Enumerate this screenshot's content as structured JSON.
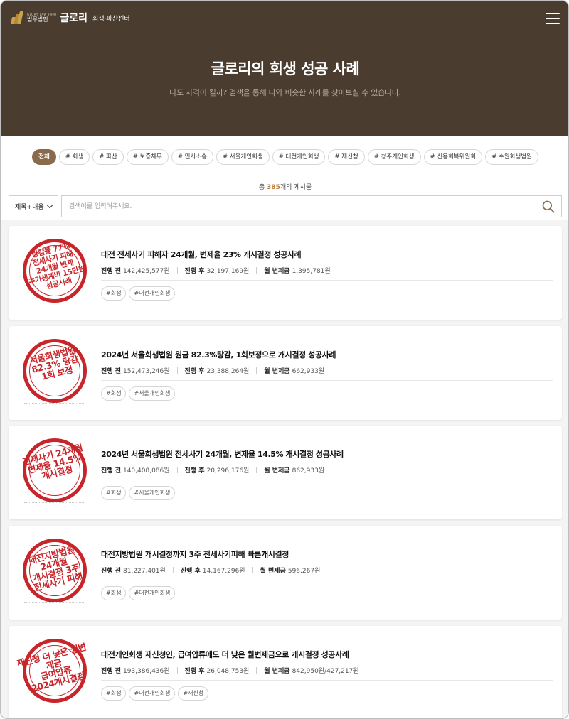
{
  "header": {
    "logo_en": "GLORY LAW FIRM",
    "logo_firm": "법무법인",
    "logo_name": "글로리",
    "logo_sub": "회생·파산센터",
    "title": "글로리의 회생 성공 사례",
    "subtitle": "나도 자격이 될까? 검색을 통해 나와 비슷한 사례를 찾아보실 수 있습니다."
  },
  "filters": {
    "tags": [
      "전체",
      "# 회생",
      "# 파산",
      "# 보증채무",
      "# 민사소송",
      "# 서울개인회생",
      "# 대전개인회생",
      "# 재신청",
      "# 청주개인회생",
      "# 신용회복위원회",
      "# 수원회생법원"
    ]
  },
  "total": {
    "prefix": "총 ",
    "count": "385",
    "suffix": "개의 게시물"
  },
  "search": {
    "select_value": "제목+내용",
    "placeholder": "검색어를 입력해주세요."
  },
  "labels": {
    "before": "진행 전",
    "after": "진행 후",
    "monthly": "월 변제금"
  },
  "cases": [
    {
      "title": "대전 전세사기 피해자 24개월, 변제율 23% 개시결정 성공사례",
      "before": "142,425,577원",
      "after": "32,197,169원",
      "monthly": "1,395,781원",
      "tags": [
        "#회생",
        "#대전개인회생"
      ],
      "stamp": [
        "탕감률 77%",
        "전세사기 피해",
        "24개월 변제",
        "추가생계비 15만원",
        "성공사례"
      ]
    },
    {
      "title": "2024년 서울회생법원 원금 82.3%탕감, 1회보정으로 개시결정 성공사례",
      "before": "152,473,246원",
      "after": "23,388,264원",
      "monthly": "662,933원",
      "tags": [
        "#회생",
        "#서울개인회생"
      ],
      "stamp": [
        "서울회생법원",
        "82.3% 탕감",
        "1회 보정"
      ]
    },
    {
      "title": "2024년 서울회생법원 전세사기 24개월, 변제율 14.5% 개시결정 성공사례",
      "before": "140,408,086원",
      "after": "20,296,176원",
      "monthly": "862,933원",
      "tags": [
        "#회생",
        "#서울개인회생"
      ],
      "stamp": [
        "전세사기 24개월",
        "변제율 14.5%",
        "개시결정"
      ]
    },
    {
      "title": "대전지방법원 개시결정까지 3주 전세사기피해 빠른개시결정",
      "before": "81,227,401원",
      "after": "14,167,296원",
      "monthly": "596,267원",
      "tags": [
        "#회생",
        "#대전개인회생"
      ],
      "stamp": [
        "대전지방법원",
        "24개월",
        "개시결정 3주",
        "전세사기 피해"
      ]
    },
    {
      "title": "대전개인회생 재신청인, 급여압류에도 더 낮은 월변제금으로 개시결정 성공사례",
      "before": "193,386,436원",
      "after": "26,048,753원",
      "monthly": "842,950원/427,217원",
      "tags": [
        "#회생",
        "#대전개인회생",
        "#재신청"
      ],
      "stamp": [
        "재신청 더 낮은 월변제금",
        "급여압류",
        "2024개시결정"
      ]
    }
  ],
  "colors": {
    "hero_bg": "#4a3d30",
    "accent": "#8a6a4c",
    "stamp_red": "#c8252b",
    "count": "#b57a3a"
  }
}
